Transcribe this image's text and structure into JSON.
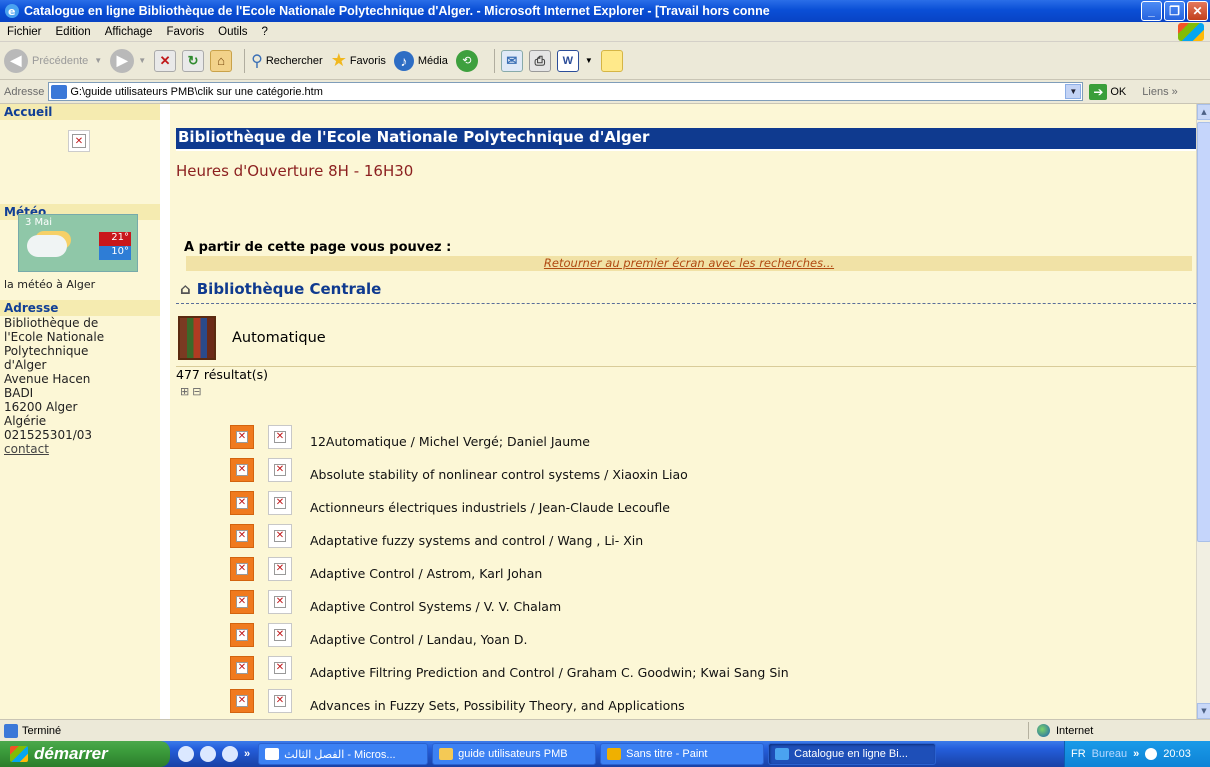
{
  "window": {
    "title": "Catalogue en ligne Bibliothèque de l'Ecole Nationale Polytechnique d'Alger. - Microsoft Internet Explorer - [Travail hors conne"
  },
  "menu": {
    "items": [
      "Fichier",
      "Edition",
      "Affichage",
      "Favoris",
      "Outils",
      "?"
    ]
  },
  "toolbar": {
    "back_label": "Précédente",
    "search_label": "Rechercher",
    "favorites_label": "Favoris",
    "media_label": "Média"
  },
  "address": {
    "label": "Adresse",
    "value": "G:\\guide utilisateurs PMB\\clik sur une catégorie.htm",
    "go_label": "OK",
    "links_label": "Liens"
  },
  "sidebar": {
    "accueil_heading": "Accueil",
    "meteo_heading": "Météo",
    "meteo_date": "3 Mai",
    "temp_max": "21°",
    "temp_min": "10°",
    "meteo_caption": "la météo à Alger",
    "adresse_heading": "Adresse",
    "adresse_lines": [
      "Bibliothèque de",
      "l'Ecole Nationale",
      "Polytechnique",
      "d'Alger",
      "Avenue Hacen",
      "BADI",
      "16200 Alger",
      "Algérie",
      "021525301/03"
    ],
    "contact_link": "contact"
  },
  "main": {
    "header": "Bibliothèque de l'Ecole Nationale Polytechnique d'Alger",
    "hours": "Heures d'Ouverture 8H - 16H30",
    "apartir": "A partir de cette page vous pouvez :",
    "retour_link": "Retourner au premier écran avec les recherches...",
    "biblio_centrale": "Bibliothèque Centrale",
    "category": "Automatique",
    "results_count": "477 résultat(s)",
    "records": [
      "12Automatique / Michel Vergé; Daniel Jaume",
      "Absolute stability of nonlinear control systems / Xiaoxin Liao",
      "Actionneurs électriques industriels / Jean-Claude Lecoufle",
      "Adaptative fuzzy systems and control / Wang , Li- Xin",
      "Adaptive Control / Astrom, Karl Johan",
      "Adaptive Control Systems / V. V. Chalam",
      "Adaptive Control / Landau, Yoan D.",
      "Adaptive Filtring Prediction and Control / Graham C. Goodwin; Kwai Sang Sin",
      "Advances in Fuzzy Sets, Possibility Theory, and Applications"
    ]
  },
  "status": {
    "text": "Terminé",
    "zone": "Internet"
  },
  "taskbar": {
    "start_label": "démarrer",
    "tasks": [
      "الفصل الثالث - Micros...",
      "guide utilisateurs PMB",
      "Sans titre - Paint",
      "Catalogue en ligne Bi..."
    ],
    "lang": "FR",
    "bureau": "Bureau",
    "clock": "20:03"
  },
  "colors": {
    "header_blue": "#0f3a8f",
    "page_bg": "#fcf7d6",
    "hours_red": "#8b1f1f",
    "link_orange": "#b04a12"
  }
}
